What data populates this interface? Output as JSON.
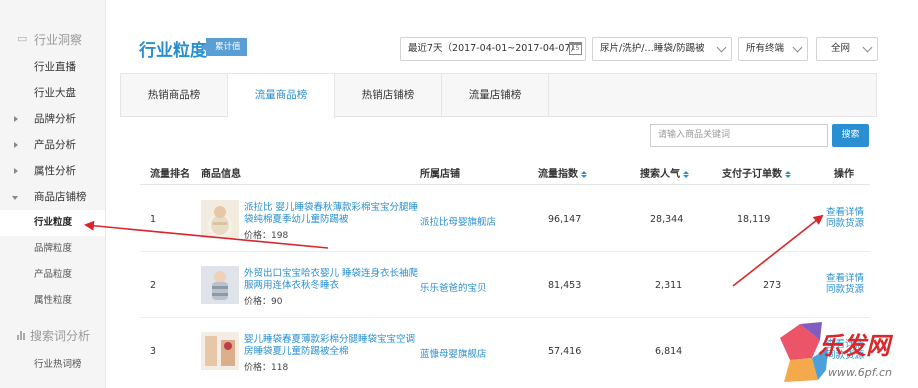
{
  "sidebar": {
    "section1": "行业洞察",
    "items": [
      {
        "label": "行业直播",
        "arrow": false
      },
      {
        "label": "行业大盘",
        "arrow": false
      },
      {
        "label": "品牌分析",
        "arrow": true
      },
      {
        "label": "产品分析",
        "arrow": true
      },
      {
        "label": "属性分析",
        "arrow": true
      },
      {
        "label": "商品店铺榜",
        "arrow": true
      }
    ],
    "subitems": [
      {
        "label": "行业粒度",
        "active": true
      },
      {
        "label": "品牌粒度",
        "active": false
      },
      {
        "label": "产品粒度",
        "active": false
      },
      {
        "label": "属性粒度",
        "active": false
      }
    ],
    "section2": "搜索词分析",
    "section2_first": "行业热词榜"
  },
  "header": {
    "title": "行业粒度",
    "badge": "累计值",
    "date_range": "最近7天（2017-04-01~2017-04-07）",
    "category": "尿片/洗护/…睡袋/防踢被",
    "terminal": "所有终端",
    "region": "全网"
  },
  "tabs": [
    "热销商品榜",
    "流量商品榜",
    "热销店铺榜",
    "流量店铺榜"
  ],
  "active_tab": 1,
  "search": {
    "placeholder": "请输入商品关键词",
    "button": "搜索"
  },
  "table": {
    "headers": {
      "rank": "流量排名",
      "product": "商品信息",
      "shop": "所属店铺",
      "traffic": "流量指数",
      "popularity": "搜索人气",
      "orders": "支付子订单数",
      "actions": "操作"
    },
    "rows": [
      {
        "rank": "1",
        "name": "派拉比 婴儿睡袋春秋薄款彩棉宝宝分腿睡袋纯棉夏季幼儿童防踢被",
        "price": "价格：198",
        "shop": "派拉比母婴旗舰店",
        "traffic": "96,147",
        "popularity": "28,344",
        "orders": "18,119",
        "action1": "查看详情",
        "action2": "同款货源"
      },
      {
        "rank": "2",
        "name": "外贸出口宝宝哈衣婴儿 睡袋连身衣长袖爬服两用连体衣秋冬睡衣",
        "price": "价格：90",
        "shop": "乐乐爸爸的宝贝",
        "traffic": "81,453",
        "popularity": "2,311",
        "orders": "273",
        "action1": "查看详情",
        "action2": "同款货源"
      },
      {
        "rank": "3",
        "name": "婴儿睡袋春夏薄款彩棉分腿睡袋宝宝空调房睡袋夏儿童防踢被全棉",
        "price": "价格：118",
        "shop": "蓝慷母婴旗舰店",
        "traffic": "57,416",
        "popularity": "6,814",
        "orders": "",
        "action1": "查看详情",
        "action2": "同款货源"
      }
    ]
  },
  "watermark": {
    "text": "乐发网",
    "url": "www.6pf.cn"
  },
  "colors": {
    "accent": "#2a8fd2",
    "arrow": "#d9262b",
    "badge": "#5a9fd4"
  }
}
